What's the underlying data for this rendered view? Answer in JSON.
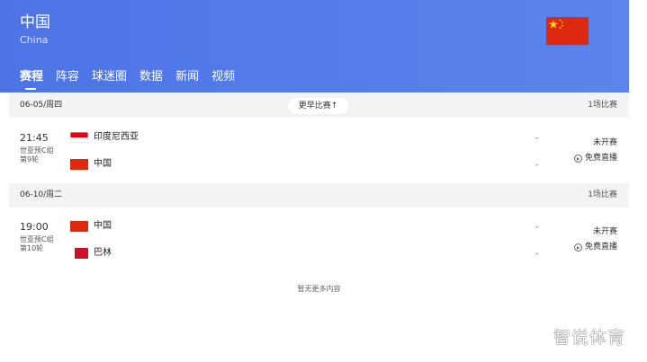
{
  "header": {
    "team_name": "中国",
    "team_name_en": "China",
    "flag_icon": "china-flag-icon",
    "bg_color": "#4d74e6"
  },
  "tabs": [
    {
      "label": "赛程",
      "active": true
    },
    {
      "label": "阵容",
      "active": false
    },
    {
      "label": "球迷圈",
      "active": false
    },
    {
      "label": "数据",
      "active": false
    },
    {
      "label": "新闻",
      "active": false
    },
    {
      "label": "视频",
      "active": false
    }
  ],
  "schedule": {
    "earlier_button": "更早比赛↑",
    "days": [
      {
        "date": "06-05/周四",
        "count": "1场比赛",
        "matches": [
          {
            "time": "21:45",
            "league": "世亚预C组",
            "round": "第9轮",
            "home": "印度尼西亚",
            "away": "中国",
            "home_score": "-",
            "away_score": "-",
            "status": "未开赛",
            "live": "免费直播"
          }
        ]
      },
      {
        "date": "06-10/周二",
        "count": "1场比赛",
        "matches": [
          {
            "time": "19:00",
            "league": "世亚预C组",
            "round": "第10轮",
            "home": "中国",
            "away": "巴林",
            "home_score": "-",
            "away_score": "-",
            "status": "未开赛",
            "live": "免费直播"
          }
        ]
      }
    ],
    "no_more": "暂无更多内容"
  },
  "watermark": "智说体育"
}
